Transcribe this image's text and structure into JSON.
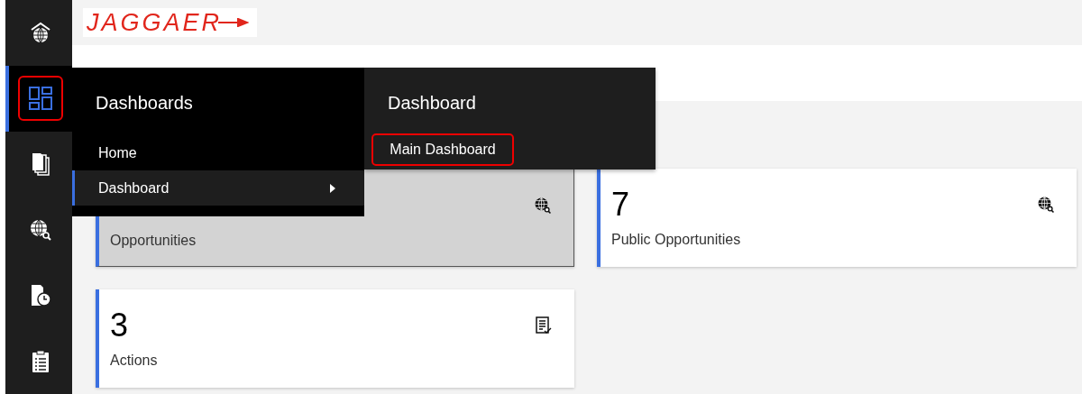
{
  "sidebar": {
    "items": [
      {
        "kind": "home",
        "selected": false,
        "highlighted": false
      },
      {
        "kind": "dashboard",
        "selected": true,
        "highlighted": true
      },
      {
        "kind": "documents",
        "selected": false,
        "highlighted": false
      },
      {
        "kind": "globe-search",
        "selected": false,
        "highlighted": false
      },
      {
        "kind": "doc-clock",
        "selected": false,
        "highlighted": false
      },
      {
        "kind": "clipboard",
        "selected": false,
        "highlighted": false
      }
    ]
  },
  "header": {
    "logo": "JAGGAER"
  },
  "menu": {
    "title": "Dashboards",
    "items": [
      {
        "label": "Home",
        "selected": false,
        "has_submenu": false
      },
      {
        "label": "Dashboard",
        "selected": true,
        "has_submenu": true
      }
    ]
  },
  "submenu": {
    "title": "Dashboard",
    "items": [
      {
        "label": "Main Dashboard",
        "highlighted": true
      }
    ]
  },
  "cards": [
    {
      "label": "Opportunities",
      "kind": "globe-search",
      "hovered": true
    },
    {
      "count": "7",
      "label": "Public Opportunities",
      "kind": "globe-search",
      "hovered": false
    },
    {
      "count": "3",
      "label": "Actions",
      "kind": "checklist",
      "hovered": false
    }
  ]
}
